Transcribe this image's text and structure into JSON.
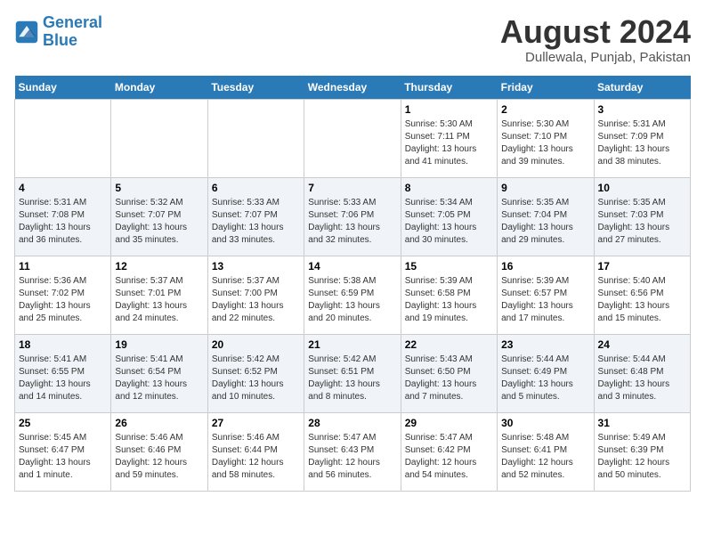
{
  "header": {
    "logo_line1": "General",
    "logo_line2": "Blue",
    "month_title": "August 2024",
    "location": "Dullewala, Punjab, Pakistan"
  },
  "weekdays": [
    "Sunday",
    "Monday",
    "Tuesday",
    "Wednesday",
    "Thursday",
    "Friday",
    "Saturday"
  ],
  "weeks": [
    [
      {
        "day": "",
        "info": ""
      },
      {
        "day": "",
        "info": ""
      },
      {
        "day": "",
        "info": ""
      },
      {
        "day": "",
        "info": ""
      },
      {
        "day": "1",
        "info": "Sunrise: 5:30 AM\nSunset: 7:11 PM\nDaylight: 13 hours\nand 41 minutes."
      },
      {
        "day": "2",
        "info": "Sunrise: 5:30 AM\nSunset: 7:10 PM\nDaylight: 13 hours\nand 39 minutes."
      },
      {
        "day": "3",
        "info": "Sunrise: 5:31 AM\nSunset: 7:09 PM\nDaylight: 13 hours\nand 38 minutes."
      }
    ],
    [
      {
        "day": "4",
        "info": "Sunrise: 5:31 AM\nSunset: 7:08 PM\nDaylight: 13 hours\nand 36 minutes."
      },
      {
        "day": "5",
        "info": "Sunrise: 5:32 AM\nSunset: 7:07 PM\nDaylight: 13 hours\nand 35 minutes."
      },
      {
        "day": "6",
        "info": "Sunrise: 5:33 AM\nSunset: 7:07 PM\nDaylight: 13 hours\nand 33 minutes."
      },
      {
        "day": "7",
        "info": "Sunrise: 5:33 AM\nSunset: 7:06 PM\nDaylight: 13 hours\nand 32 minutes."
      },
      {
        "day": "8",
        "info": "Sunrise: 5:34 AM\nSunset: 7:05 PM\nDaylight: 13 hours\nand 30 minutes."
      },
      {
        "day": "9",
        "info": "Sunrise: 5:35 AM\nSunset: 7:04 PM\nDaylight: 13 hours\nand 29 minutes."
      },
      {
        "day": "10",
        "info": "Sunrise: 5:35 AM\nSunset: 7:03 PM\nDaylight: 13 hours\nand 27 minutes."
      }
    ],
    [
      {
        "day": "11",
        "info": "Sunrise: 5:36 AM\nSunset: 7:02 PM\nDaylight: 13 hours\nand 25 minutes."
      },
      {
        "day": "12",
        "info": "Sunrise: 5:37 AM\nSunset: 7:01 PM\nDaylight: 13 hours\nand 24 minutes."
      },
      {
        "day": "13",
        "info": "Sunrise: 5:37 AM\nSunset: 7:00 PM\nDaylight: 13 hours\nand 22 minutes."
      },
      {
        "day": "14",
        "info": "Sunrise: 5:38 AM\nSunset: 6:59 PM\nDaylight: 13 hours\nand 20 minutes."
      },
      {
        "day": "15",
        "info": "Sunrise: 5:39 AM\nSunset: 6:58 PM\nDaylight: 13 hours\nand 19 minutes."
      },
      {
        "day": "16",
        "info": "Sunrise: 5:39 AM\nSunset: 6:57 PM\nDaylight: 13 hours\nand 17 minutes."
      },
      {
        "day": "17",
        "info": "Sunrise: 5:40 AM\nSunset: 6:56 PM\nDaylight: 13 hours\nand 15 minutes."
      }
    ],
    [
      {
        "day": "18",
        "info": "Sunrise: 5:41 AM\nSunset: 6:55 PM\nDaylight: 13 hours\nand 14 minutes."
      },
      {
        "day": "19",
        "info": "Sunrise: 5:41 AM\nSunset: 6:54 PM\nDaylight: 13 hours\nand 12 minutes."
      },
      {
        "day": "20",
        "info": "Sunrise: 5:42 AM\nSunset: 6:52 PM\nDaylight: 13 hours\nand 10 minutes."
      },
      {
        "day": "21",
        "info": "Sunrise: 5:42 AM\nSunset: 6:51 PM\nDaylight: 13 hours\nand 8 minutes."
      },
      {
        "day": "22",
        "info": "Sunrise: 5:43 AM\nSunset: 6:50 PM\nDaylight: 13 hours\nand 7 minutes."
      },
      {
        "day": "23",
        "info": "Sunrise: 5:44 AM\nSunset: 6:49 PM\nDaylight: 13 hours\nand 5 minutes."
      },
      {
        "day": "24",
        "info": "Sunrise: 5:44 AM\nSunset: 6:48 PM\nDaylight: 13 hours\nand 3 minutes."
      }
    ],
    [
      {
        "day": "25",
        "info": "Sunrise: 5:45 AM\nSunset: 6:47 PM\nDaylight: 13 hours\nand 1 minute."
      },
      {
        "day": "26",
        "info": "Sunrise: 5:46 AM\nSunset: 6:46 PM\nDaylight: 12 hours\nand 59 minutes."
      },
      {
        "day": "27",
        "info": "Sunrise: 5:46 AM\nSunset: 6:44 PM\nDaylight: 12 hours\nand 58 minutes."
      },
      {
        "day": "28",
        "info": "Sunrise: 5:47 AM\nSunset: 6:43 PM\nDaylight: 12 hours\nand 56 minutes."
      },
      {
        "day": "29",
        "info": "Sunrise: 5:47 AM\nSunset: 6:42 PM\nDaylight: 12 hours\nand 54 minutes."
      },
      {
        "day": "30",
        "info": "Sunrise: 5:48 AM\nSunset: 6:41 PM\nDaylight: 12 hours\nand 52 minutes."
      },
      {
        "day": "31",
        "info": "Sunrise: 5:49 AM\nSunset: 6:39 PM\nDaylight: 12 hours\nand 50 minutes."
      }
    ]
  ]
}
